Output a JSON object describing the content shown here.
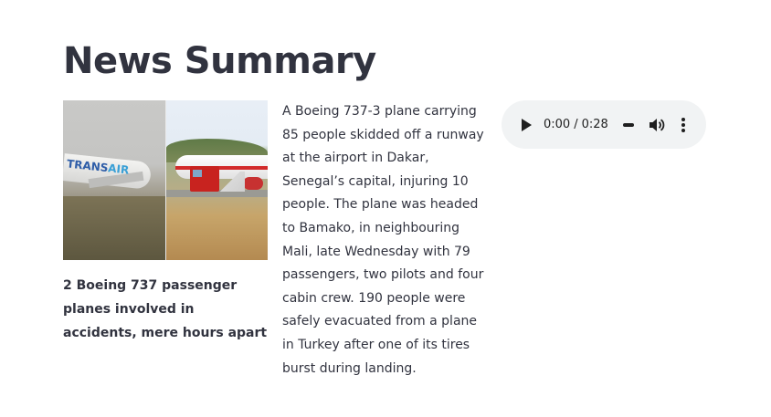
{
  "page": {
    "title": "News Summary"
  },
  "article": {
    "image": {
      "left_airline_text_a": "TRANS",
      "left_airline_text_b": "AIR",
      "icon": "news-photo-composite"
    },
    "caption": "2 Boeing 737 passenger planes involved in accidents, mere hours apart",
    "summary": "A Boeing 737-3 plane carrying 85 people skidded off a runway at the airport in Dakar, Senegal’s capital, injuring 10 people. The plane was headed to Bamako, in neighbouring Mali, late Wednesday with 79 passengers, two pilots and four cabin crew. 190 people were safely evacuated from a plane in Turkey after one of its tires burst during landing."
  },
  "audio": {
    "current_time": "0:00",
    "separator": "/",
    "duration": "0:28",
    "progress_fraction": 0,
    "icons": {
      "play": "play-icon",
      "volume": "volume-icon",
      "more": "more-vertical-icon"
    },
    "background_color": "#f1f3f4"
  },
  "colors": {
    "text": "#31333f",
    "background": "#ffffff"
  }
}
